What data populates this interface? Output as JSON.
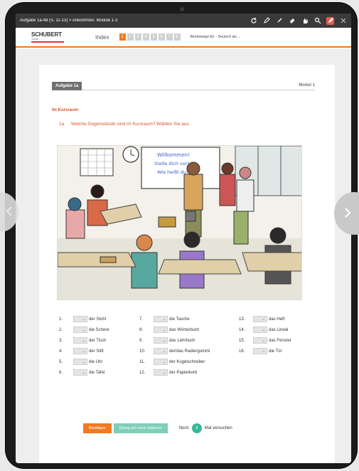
{
  "topbar": {
    "title": "Aufgabe 1a-4d (S. 11-13) > Ankommen: Module 1-3",
    "icons": [
      "refresh-icon",
      "pen-icon",
      "pencil-icon",
      "eraser-icon",
      "hand-icon",
      "search-icon",
      "marker-icon",
      "close-icon"
    ]
  },
  "navbar": {
    "logo_text": "SCHUBERT",
    "logo_sub": "Verlag",
    "index_label": "Index",
    "pages": [
      "1",
      "2",
      "3",
      "4",
      "5",
      "6",
      "7",
      "8"
    ],
    "current_page": "1",
    "book_title": "Berufswege A2 – Deutsch als ..."
  },
  "exercise": {
    "tab": "Aufgabe 1a",
    "module": "Modul 1",
    "section": "Im Kursraum",
    "task_num": "1a",
    "task_text": "Welche Gegenstände sind im Kursraum? Wählen Sie aus.",
    "board_lines": [
      "Willkommen!",
      "Stelle dich vor!",
      "Wie heißt du?"
    ]
  },
  "items": [
    {
      "n": "1.",
      "label": "der Stuhl"
    },
    {
      "n": "2.",
      "label": "die Schere"
    },
    {
      "n": "3.",
      "label": "der Tisch"
    },
    {
      "n": "4.",
      "label": "der Stift"
    },
    {
      "n": "5.",
      "label": "die Uhr"
    },
    {
      "n": "6.",
      "label": "die Tafel"
    },
    {
      "n": "7.",
      "label": "die Tasche"
    },
    {
      "n": "8.",
      "label": "das Wörterbuch"
    },
    {
      "n": "9.",
      "label": "das Lehrbuch"
    },
    {
      "n": "10.",
      "label": "der/das Radiergummi"
    },
    {
      "n": "11.",
      "label": "der Kugelschreiber"
    },
    {
      "n": "12.",
      "label": "der Papierkorb"
    },
    {
      "n": "13.",
      "label": "das Heft"
    },
    {
      "n": "14.",
      "label": "das Lineal"
    },
    {
      "n": "15.",
      "label": "das Fenster"
    },
    {
      "n": "16.",
      "label": "die Tür"
    }
  ],
  "actions": {
    "confirm": "Bestätigen",
    "restart": "Übung von vorne beginnen",
    "tries_prefix": "Noch",
    "tries_count": "3",
    "tries_suffix": "Mal versuchen"
  },
  "colors": {
    "accent": "#f07a22",
    "teal": "#38b89a",
    "red": "#d9512c"
  }
}
